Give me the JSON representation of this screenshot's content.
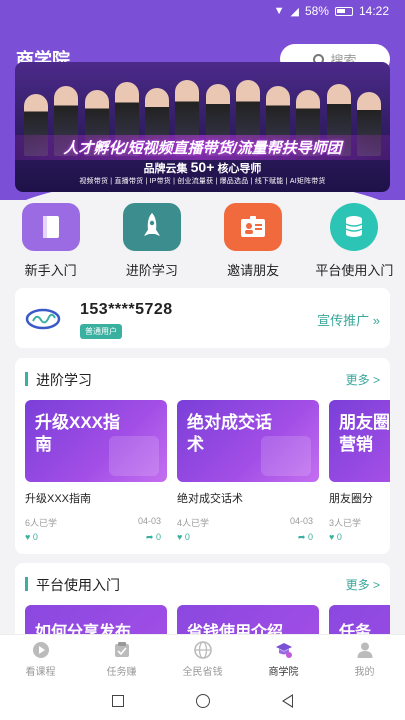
{
  "status_bar": {
    "battery": "58%",
    "time": "14:22"
  },
  "header": {
    "title": "商学院",
    "search_placeholder": "搜索"
  },
  "banner": {
    "headline": "人才孵化/短视频直播带货/流量帮扶导师团",
    "sub_prefix": "品牌云集",
    "sub_highlight": "50+",
    "sub_suffix": "核心导师",
    "tags": "视频带货 | 直播带货 | IP带货 | 创业流量获 | 爆品选品 | 线下赋能 | AI矩阵带货"
  },
  "quick_entries": [
    {
      "label": "新手入门",
      "icon": "book-icon"
    },
    {
      "label": "进阶学习",
      "icon": "rocket-icon"
    },
    {
      "label": "邀请朋友",
      "icon": "id-card-icon"
    },
    {
      "label": "平台使用入门",
      "icon": "database-icon"
    }
  ],
  "user": {
    "phone": "153****5728",
    "level": "普通用户",
    "promo": "宣传推广 »"
  },
  "advanced": {
    "title": "进阶学习",
    "more": "更多 >",
    "courses": [
      {
        "thumb_text": "升级XXX指南",
        "title": "升级XXX指南",
        "learners": "6人已学",
        "date": "04-03",
        "likes": "0",
        "shares": "0"
      },
      {
        "thumb_text": "绝对成交话术",
        "title": "绝对成交话术",
        "learners": "4人已学",
        "date": "04-03",
        "likes": "0",
        "shares": "0"
      },
      {
        "thumb_text": "朋友圈营销",
        "title": "朋友圈分",
        "learners": "3人已学",
        "likes": "0"
      }
    ]
  },
  "platform": {
    "title": "平台使用入门",
    "more": "更多 >",
    "courses": [
      {
        "thumb_text": "如何分享发布"
      },
      {
        "thumb_text": "省钱使用介绍"
      },
      {
        "thumb_text": "任务"
      }
    ]
  },
  "tabs": [
    {
      "label": "看课程",
      "icon": "play-circle-icon",
      "active": false
    },
    {
      "label": "任务赚",
      "icon": "task-icon",
      "active": false
    },
    {
      "label": "全民省钱",
      "icon": "globe-icon",
      "active": false
    },
    {
      "label": "商学院",
      "icon": "graduation-icon",
      "active": true
    },
    {
      "label": "我的",
      "icon": "user-icon",
      "active": false
    }
  ],
  "colors": {
    "brand": "#7b4fd6",
    "accent": "#3ab0a0"
  }
}
